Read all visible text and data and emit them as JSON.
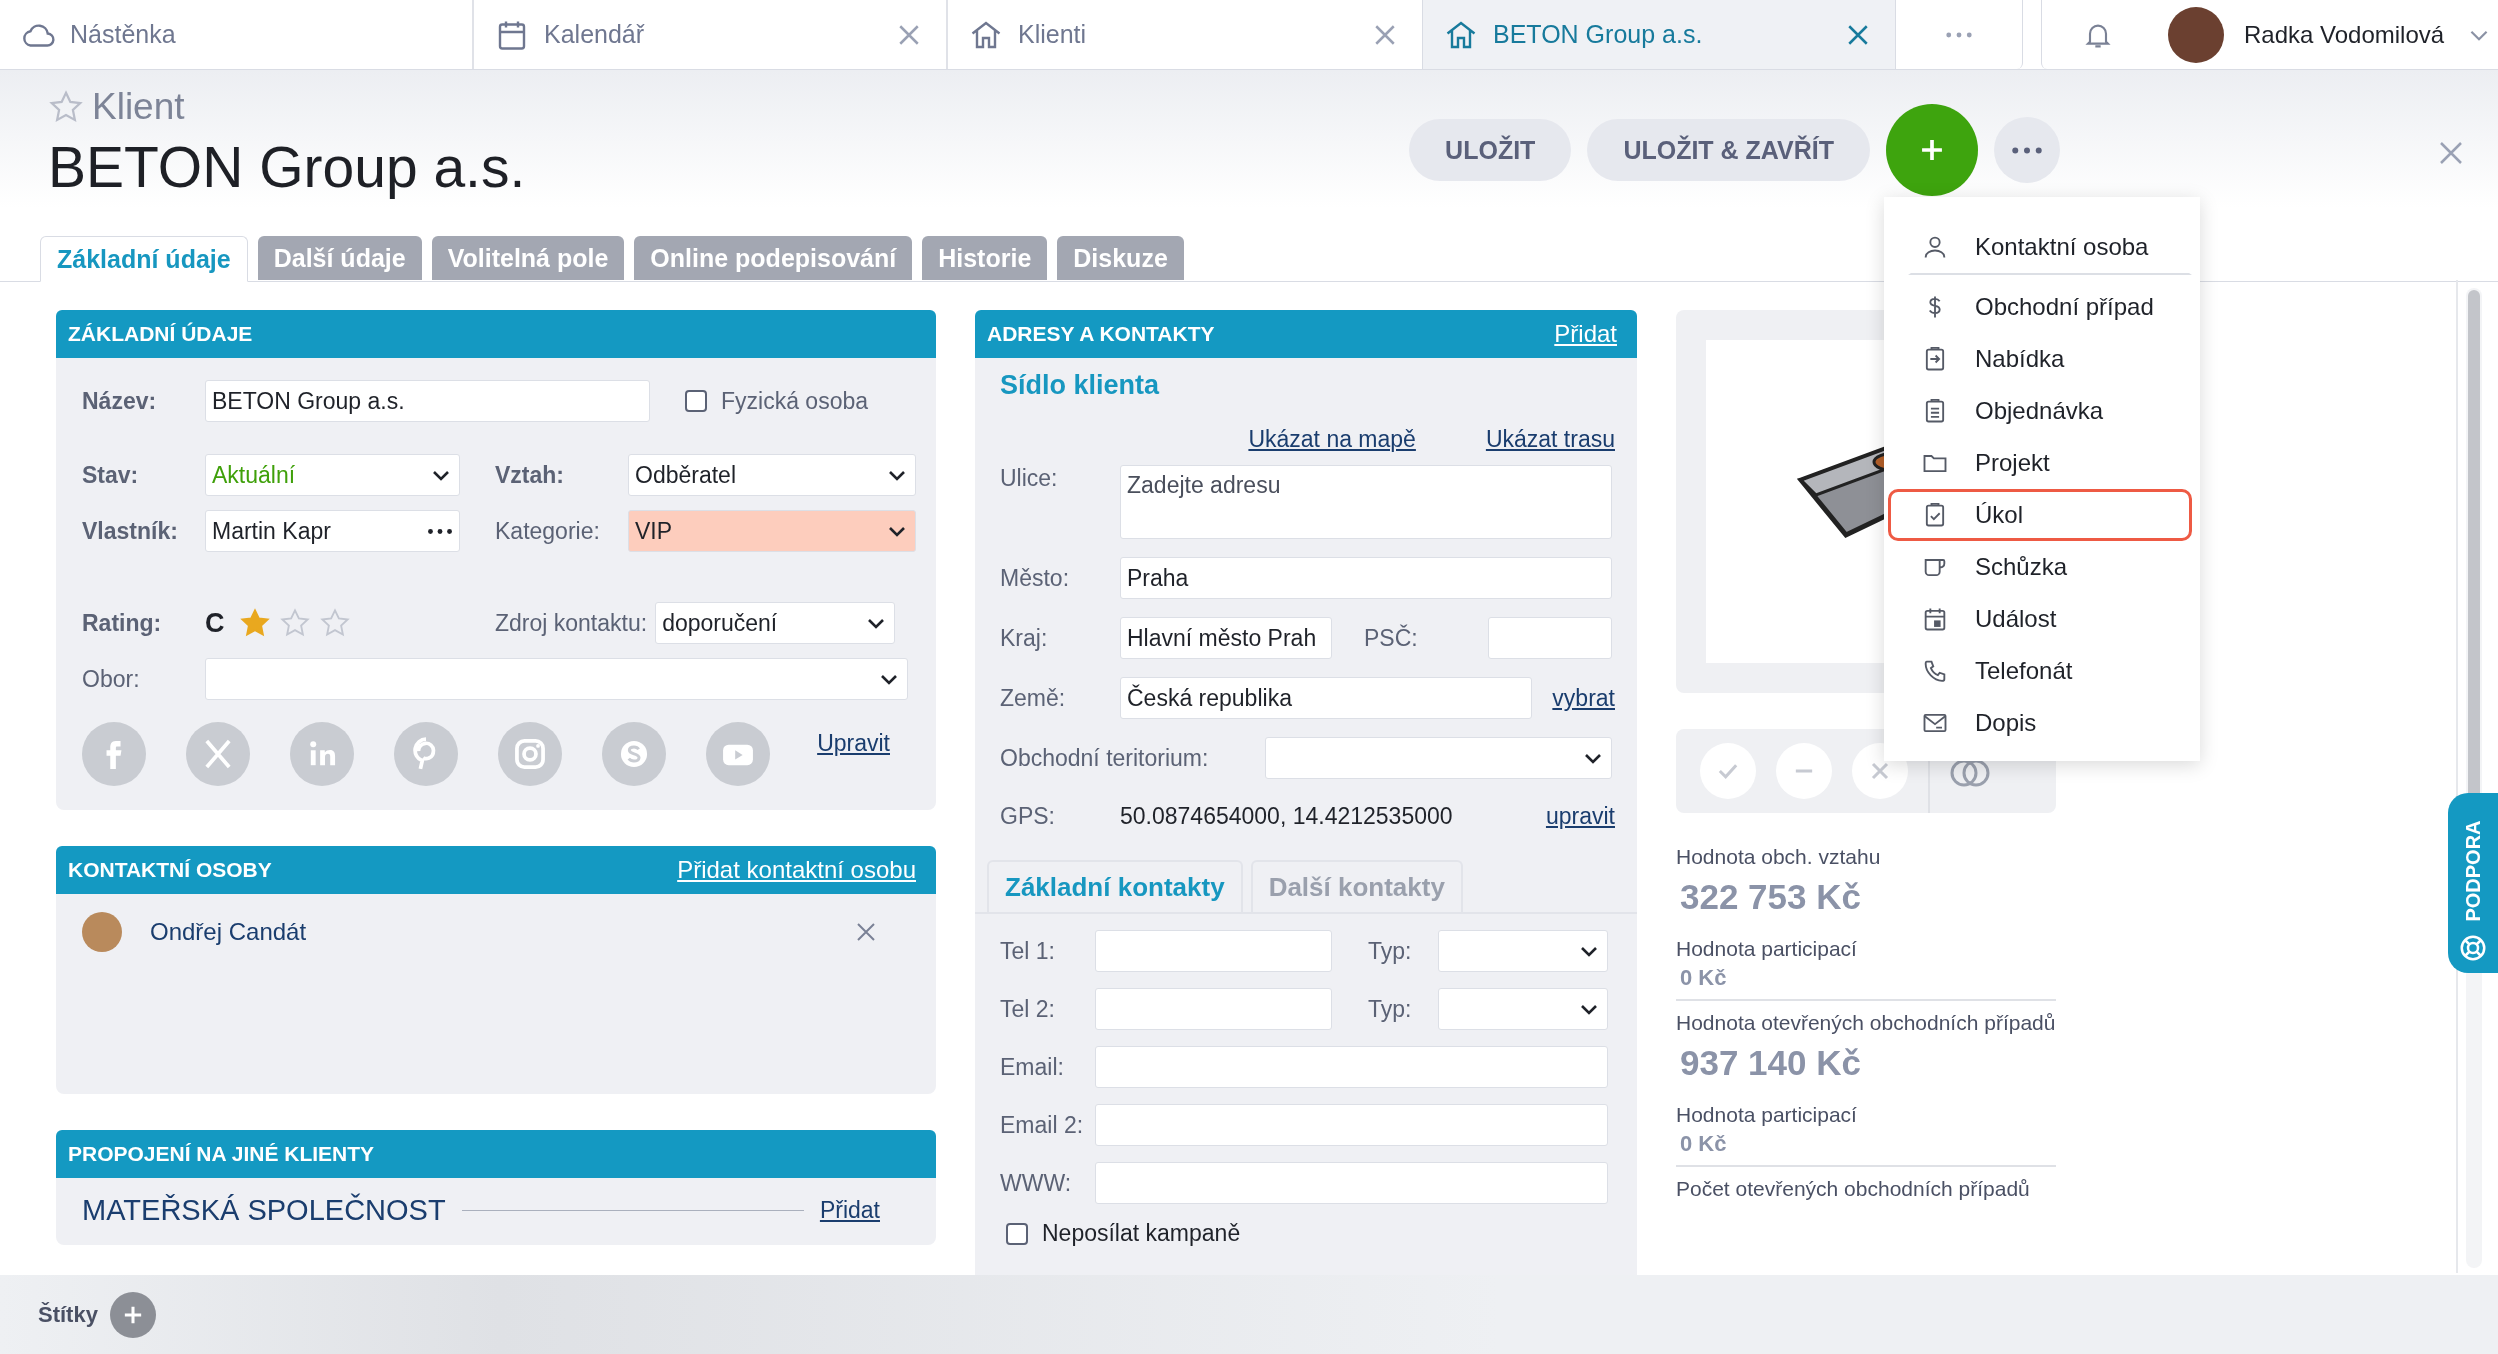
{
  "top_tabs": [
    {
      "label": "Nástěnka",
      "selected": false,
      "closable": false
    },
    {
      "label": "Kalendář",
      "selected": false,
      "closable": true
    },
    {
      "label": "Klienti",
      "selected": false,
      "closable": true
    },
    {
      "label": "BETON Group a.s.",
      "selected": true,
      "closable": true
    }
  ],
  "user": {
    "name": "Radka Vodomilová"
  },
  "header": {
    "type_label": "Klient",
    "favorite": false,
    "title": "BETON Group a.s."
  },
  "actions": [
    "ULOŽIT",
    "ULOŽIT & ZAVŘÍT"
  ],
  "add_menu": [
    {
      "label": "Kontaktní osoba",
      "selected": false
    },
    {
      "label": "Obchodní případ",
      "selected": false
    },
    {
      "label": "Nabídka",
      "selected": false
    },
    {
      "label": "Objednávka",
      "selected": false
    },
    {
      "label": "Projekt",
      "selected": false
    },
    {
      "label": "Úkol",
      "selected": true
    },
    {
      "label": "Schůzka",
      "selected": false
    },
    {
      "label": "Událost",
      "selected": false
    },
    {
      "label": "Telefonát",
      "selected": false
    },
    {
      "label": "Dopis",
      "selected": false
    }
  ],
  "tabs": [
    {
      "label": "Základní údaje",
      "selected": true
    },
    {
      "label": "Další údaje",
      "selected": false
    },
    {
      "label": "Volitelná pole",
      "selected": false
    },
    {
      "label": "Online podepisování",
      "selected": false
    },
    {
      "label": "Historie",
      "selected": false
    },
    {
      "label": "Diskuze",
      "selected": false
    }
  ],
  "basic": {
    "title": "ZÁKLADNÍ ÚDAJE",
    "name": {
      "label": "Název:",
      "required": true,
      "value": "BETON Group a.s."
    },
    "person": {
      "label": "Fyzická osoba",
      "checked": false
    },
    "stav": {
      "label": "Stav:",
      "required": true,
      "value": "Aktuální",
      "color": "#3fa00a"
    },
    "vztah": {
      "label": "Vztah:",
      "required": true,
      "value": "Odběratel"
    },
    "vlastnik": {
      "label": "Vlastník:",
      "required": true,
      "value": "Martin Kapr"
    },
    "kategorie": {
      "label": "Kategorie:",
      "required": false,
      "value": "VIP",
      "color": "#fdcdbd"
    },
    "rating": {
      "label": "Rating:",
      "required": true,
      "grade": "C",
      "stars": 1
    },
    "zdroj": {
      "label": "Zdroj kontaktu:",
      "required": false,
      "value": "doporučení"
    },
    "obor": {
      "label": "Obor:",
      "required": false
    },
    "edit_link": "Upravit"
  },
  "contacts": {
    "title": "KONTAKTNÍ OSOBY",
    "add_link": "Přidat kontaktní osobu",
    "people": [
      {
        "name": "Ondřej Candát"
      }
    ]
  },
  "links": {
    "title": "PROPOJENÍ NA JINÉ KLIENTY",
    "section": "MATEŘSKÁ SPOLEČNOST",
    "add_link": "Přidat"
  },
  "address": {
    "title": "ADRESY A KONTAKTY",
    "add_link": "Přidat",
    "subtitle": "Sídlo klienta",
    "map_link": "Ukázat na mapě",
    "route_link": "Ukázat trasu",
    "street": {
      "label": "Ulice:",
      "placeholder": "Zadejte adresu"
    },
    "city": {
      "label": "Město:",
      "value": "Praha"
    },
    "region": {
      "label": "Kraj:",
      "value": "Hlavní město Prah"
    },
    "zip": {
      "label": "PSČ:"
    },
    "country": {
      "label": "Země:",
      "value": "Česká republika",
      "link": "vybrat"
    },
    "territory": {
      "label": "Obchodní teritorium:"
    },
    "gps": {
      "label": "GPS:",
      "value": "50.0874654000, 14.4212535000",
      "link": "upravit"
    }
  },
  "contact_tabs": [
    {
      "label": "Základní kontakty",
      "selected": true
    },
    {
      "label": "Další kontakty",
      "selected": false
    }
  ],
  "contact_fields": [
    {
      "kind": "phone",
      "label": "Tel 1:",
      "type_label": "Typ:"
    },
    {
      "kind": "phone",
      "label": "Tel 2:",
      "type_label": "Typ:"
    },
    {
      "kind": "text",
      "label": "Email:"
    },
    {
      "kind": "text",
      "label": "Email 2:"
    },
    {
      "kind": "text",
      "label": "WWW:"
    }
  ],
  "no_campaigns": {
    "label": "Neposílat kampaně",
    "checked": false
  },
  "stats": [
    {
      "kind": "large",
      "label": "Hodnota obch. vztahu",
      "value": "322 753 Kč"
    },
    {
      "kind": "small",
      "label": "Hodnota participací",
      "value": "0 Kč"
    },
    {
      "kind": "large",
      "label": "Hodnota otevřených obchodních případů",
      "value": "937 140 Kč"
    },
    {
      "kind": "small",
      "label": "Hodnota participací",
      "value": "0 Kč"
    },
    {
      "kind": "label",
      "label": "Počet otevřených obchodních případů"
    }
  ],
  "support": "PODPORA",
  "tags": "Štítky"
}
